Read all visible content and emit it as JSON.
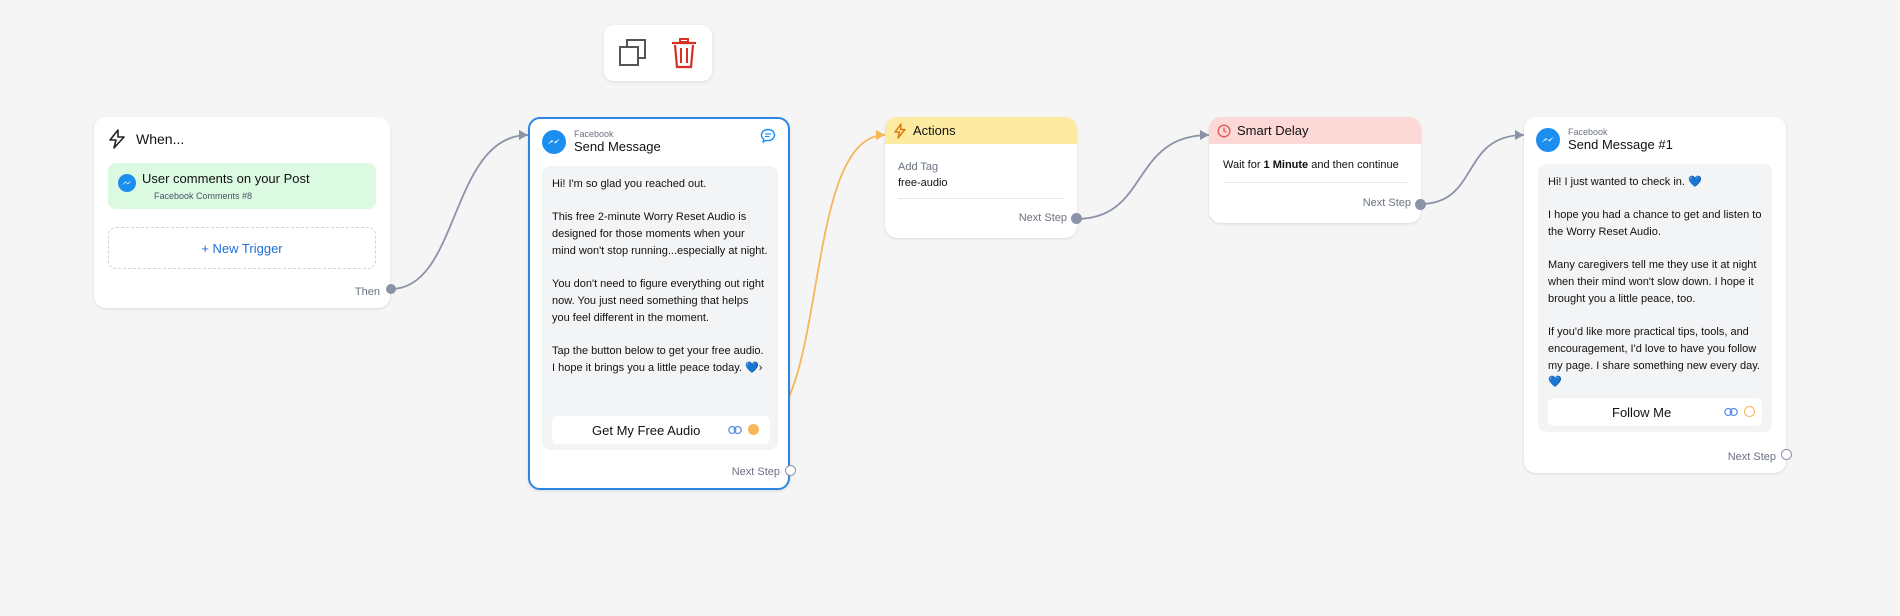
{
  "toolbar": {
    "copy_icon": "copy-icon",
    "delete_icon": "trash-icon",
    "delete_color": "#d93025"
  },
  "trigger": {
    "title": "When...",
    "item_title": "User comments on your Post",
    "item_sub": "Facebook Comments #8",
    "new_trigger": "+ New Trigger",
    "then": "Then",
    "bg": "#dcf9e2"
  },
  "send1": {
    "platform": "Facebook",
    "title": "Send Message",
    "paragraphs": [
      "Hi! I'm so glad you reached out.",
      "This free 2-minute Worry Reset Audio is designed for those moments when your mind won't stop running...especially at night.",
      "You don't need to figure everything out right now. You just need something that helps you feel different in the moment.",
      "Tap the button below to get your free audio. I hope it brings you a little peace today. 💙›"
    ],
    "button": "Get My Free Audio",
    "next": "Next Step"
  },
  "actions": {
    "title": "Actions",
    "label": "Add Tag",
    "value": "free-audio",
    "next": "Next Step",
    "bg": "#fdeba1"
  },
  "delay": {
    "title": "Smart Delay",
    "text_before": "Wait for ",
    "text_bold": "1 Minute",
    "text_after": " and then continue",
    "next": "Next Step",
    "bg": "#fcd9d6"
  },
  "send2": {
    "platform": "Facebook",
    "title": "Send Message #1",
    "paragraphs": [
      "Hi! I just wanted to check in. 💙",
      "I hope you had a chance to get and listen to the Worry Reset Audio.",
      "Many caregivers tell me they use it at night when their mind won't slow down. I hope it brought you a little peace, too.",
      "If you'd like more practical tips, tools, and encouragement, I'd love to have you follow my page. I share something new every day. 💙"
    ],
    "button": "Follow Me",
    "next": "Next Step"
  },
  "colors": {
    "accent": "#2d86e0",
    "wire_gray": "#8b93a8",
    "wire_orange": "#f5b75a",
    "messenger": "#1c8ef0"
  }
}
